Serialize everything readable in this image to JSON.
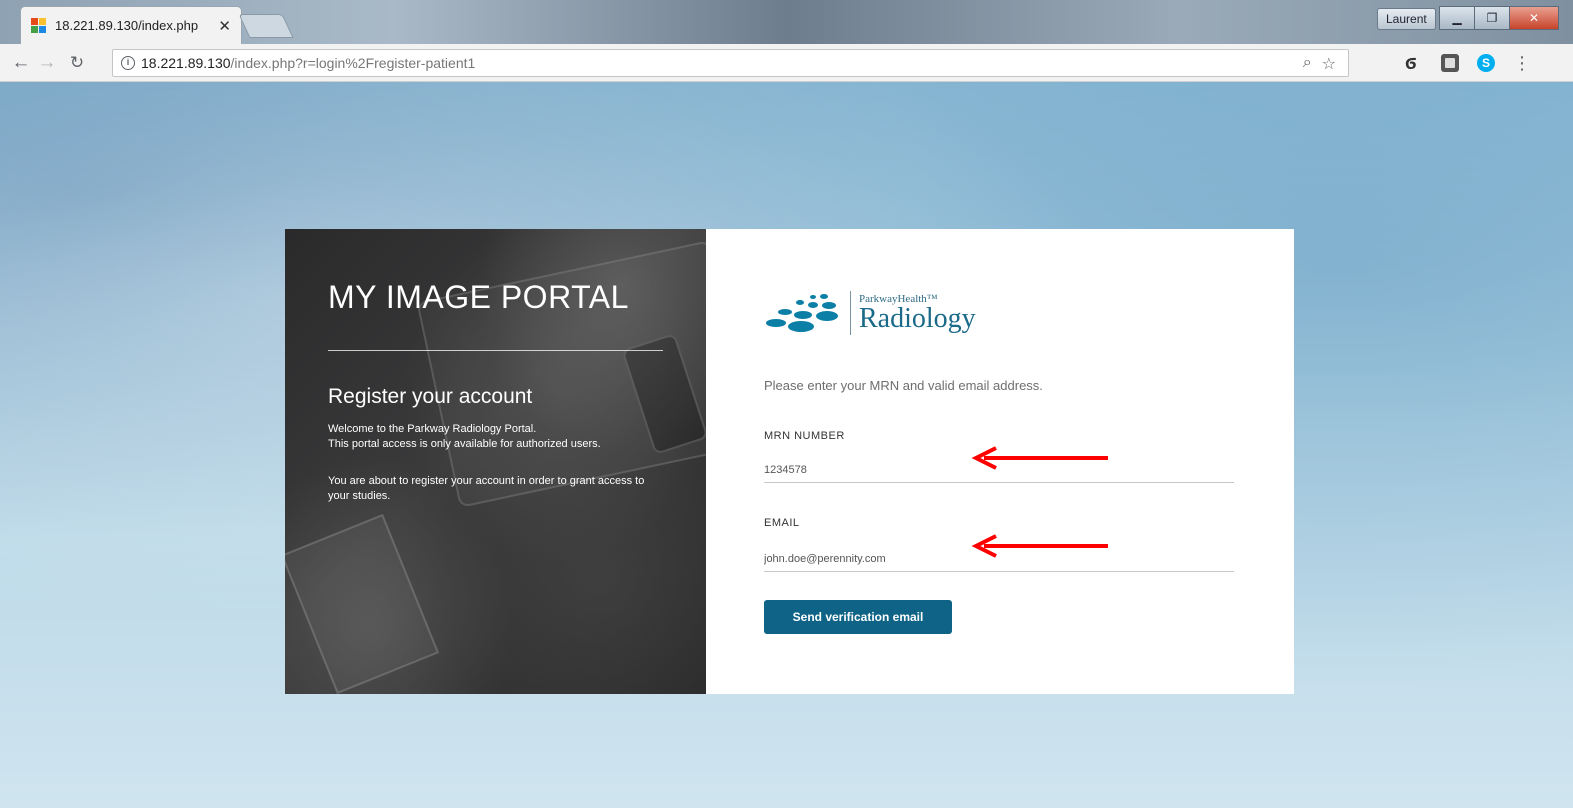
{
  "browser": {
    "tab_title": "18.221.89.130/index.php",
    "tab_close": "✕",
    "user_badge": "Laurent",
    "url_host": "18.221.89.130",
    "url_path": "/index.php?r=login%2Fregister-patient1",
    "icons": [
      "back-icon",
      "forward-icon",
      "reload-icon",
      "info-icon",
      "zoom-icon",
      "star-icon",
      "flame-extension-icon",
      "square-extension-icon",
      "skype-icon",
      "menu-icon"
    ]
  },
  "left_panel": {
    "portal_title": "MY IMAGE PORTAL",
    "register_title": "Register your account",
    "welcome_line_1": "Welcome to the Parkway Radiology Portal.",
    "welcome_line_2": "This portal access is only available for authorized users.",
    "about_text": "You are about to register your account in order to grant access to your studies."
  },
  "right_panel": {
    "logo_sub": "ParkwayHealth™",
    "logo_main": "Radiology",
    "instruction": "Please enter your MRN and valid email address.",
    "mrn_label": "MRN NUMBER",
    "mrn_value": "1234578",
    "email_label": "EMAIL",
    "email_value": "john.doe@perennity.com",
    "send_button": "Send verification email"
  },
  "colors": {
    "accent": "#0e6386",
    "annotation_arrow": "#ff0000"
  }
}
